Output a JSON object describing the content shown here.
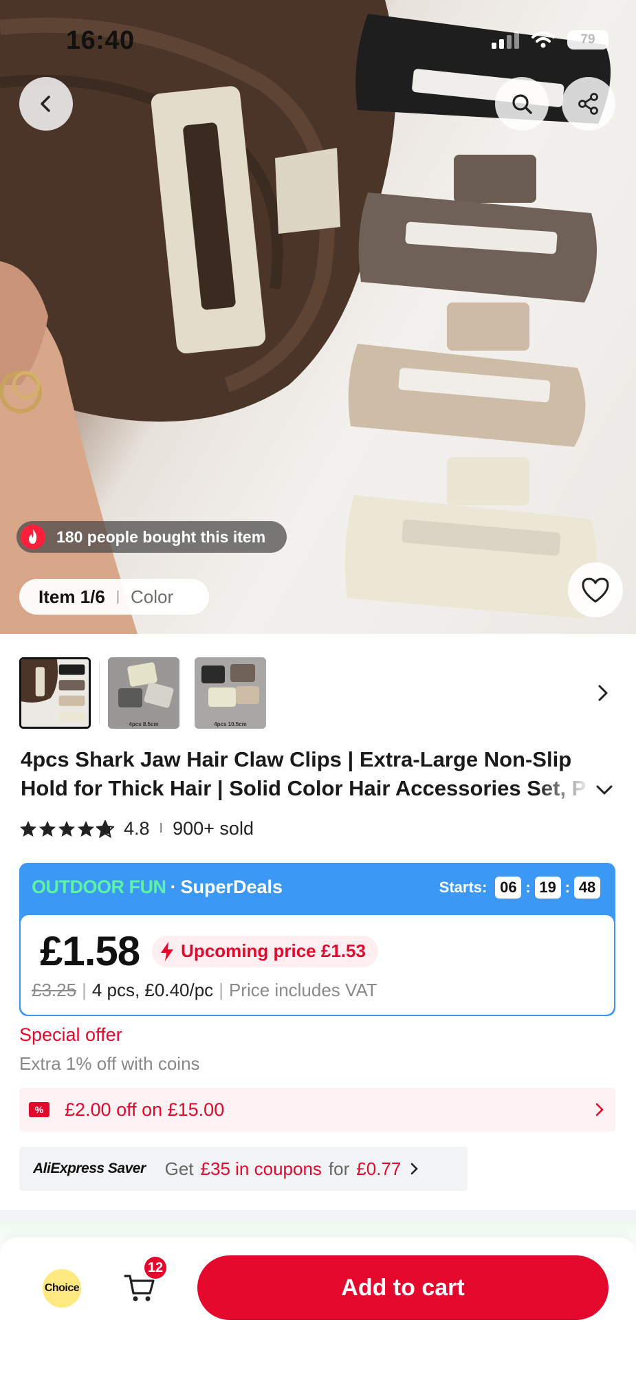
{
  "status_bar": {
    "time": "16:40",
    "battery": "79"
  },
  "hero": {
    "bought_text": "180 people bought this item",
    "item_count": "Item 1/6",
    "item_sep": "|",
    "item_color": "Color"
  },
  "thumbnails": [
    {
      "caption": ""
    },
    {
      "caption": "4pcs 8.5cm"
    },
    {
      "caption": "4pcs 10.5cm"
    }
  ],
  "product": {
    "title": "4pcs Shark Jaw Hair Claw Clips | Extra-Large Non-Slip Hold for Thick Hair | Solid Color Hair Accessories Set, P",
    "rating": "4.8",
    "rating_sep": "I",
    "sold": "900+ sold",
    "stars": 4.8
  },
  "deal": {
    "outdoor": "OUTDOOR FUN",
    "dot": "·",
    "superdeals": "SuperDeals",
    "starts_label": "Starts:",
    "hours": "06",
    "minutes": "19",
    "seconds": "48",
    "colon": ":",
    "price": "£1.58",
    "upcoming": "Upcoming price £1.53",
    "original_price": "£3.25",
    "bar": "|",
    "unit_info": "4 pcs, £0.40/pc",
    "vat": "Price includes VAT"
  },
  "offers": {
    "special": "Special offer",
    "coins": "Extra 1% off with coins",
    "coupon_icon": "%",
    "coupon": "£2.00 off on £15.00",
    "saver_logo_a": "AliExpress",
    "saver_logo_b": "Saver",
    "saver_get": "Get",
    "saver_coupons": "£35 in coupons",
    "saver_for": "for",
    "saver_price": "£0.77"
  },
  "bottom": {
    "choice": "Choice",
    "cart_count": "12",
    "add_to_cart": "Add to cart"
  },
  "colors": {
    "accent_red": "#e5082d",
    "deal_blue": "#3b98f5",
    "outdoor_green": "#5df2a6",
    "choice_yellow": "#ffe980"
  }
}
